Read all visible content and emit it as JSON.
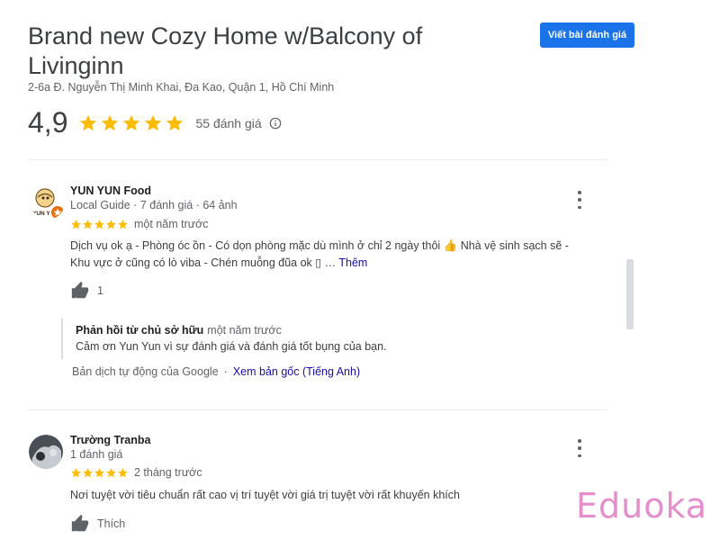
{
  "place": {
    "title": "Brand new Cozy Home w/Balcony of Livinginn",
    "address": "2-6a Đ. Nguyễn Thị Minh Khai, Đa Kao, Quận 1, Hồ Chí Minh",
    "write_review_label": "Viết bài đánh giá",
    "rating": "4,9",
    "rating_stars": 5,
    "review_count": "55 đánh giá",
    "info_icon": "info-icon"
  },
  "reviews": [
    {
      "author": "YUN YUN Food",
      "meta": "Local Guide · 7 đánh giá · 64 ảnh",
      "stars": 5,
      "date": "một năm trước",
      "text_line1": "Dịch vụ ok ạ - Phòng óc ồn - Có dọn phòng mặc dù mình ở chỉ 2 ngày thôi 👍 Nhà vệ sinh sạch sẽ -",
      "text_line2": "Khu vực ở cũng có lò viba - Chén muỗng đũa ok  ▯ … ",
      "more_label": "Thêm",
      "like_count": "1",
      "avatar_label": "YUN Y",
      "owner_reply": {
        "title": "Phản hồi từ chủ sở hữu",
        "date": "một năm trước",
        "text": "Cảm ơn Yun Yun vì sự đánh giá và đánh giá tốt bụng của bạn."
      },
      "translation": {
        "note": "Bản dịch tự động của Google",
        "separator": "·",
        "link": "Xem bản gốc (Tiếng Anh)"
      }
    },
    {
      "author": "Trường Tranba",
      "meta": "1 đánh giá",
      "stars": 5,
      "date": "2 tháng trước",
      "text_line1": "Nơi tuyệt vời tiêu chuẩn rất cao vị trí tuyệt vời giá trị tuyệt vời rất khuyến khích",
      "like_label": "Thích"
    }
  ],
  "watermark": "Eduoka",
  "colors": {
    "star": "#fbbc04",
    "button": "#1a73e8",
    "link": "#1a0dab",
    "watermark": "#e48fcb"
  }
}
